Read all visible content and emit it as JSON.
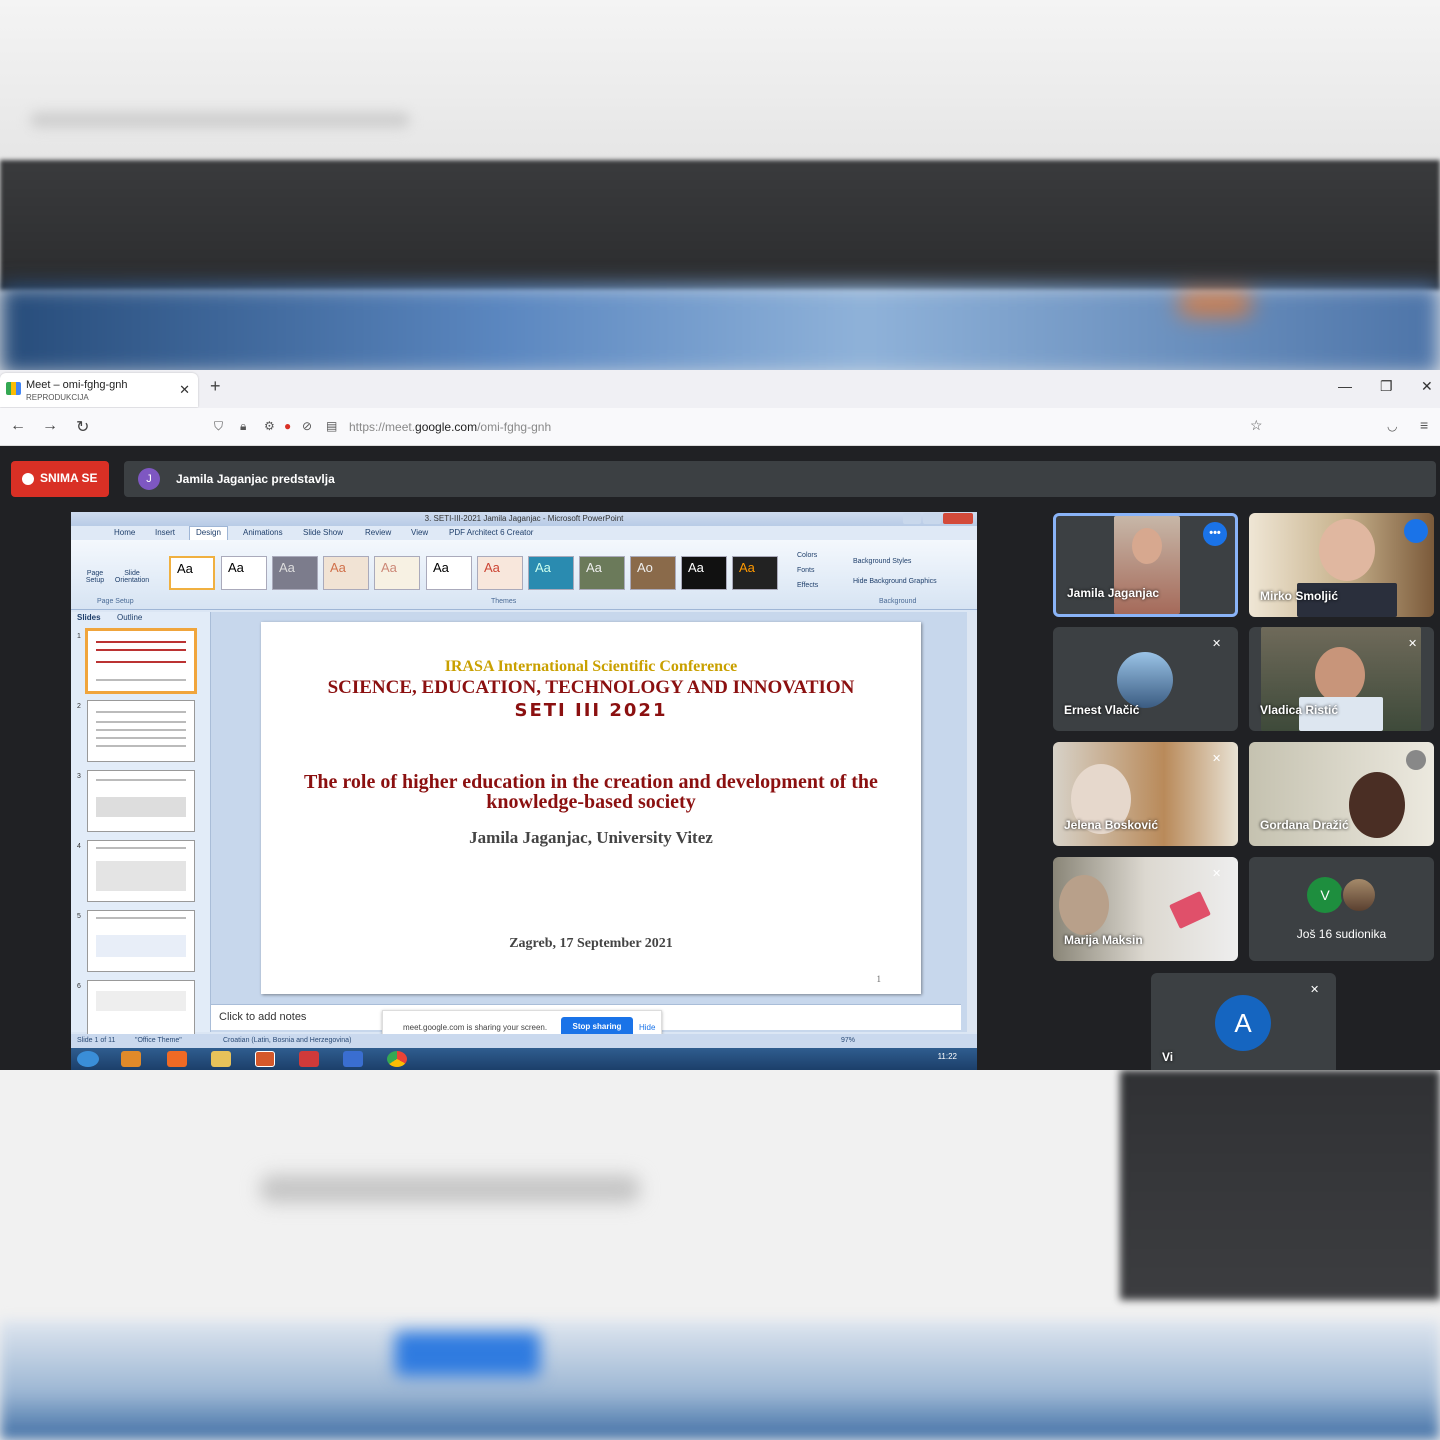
{
  "browser": {
    "tab_title": "Meet – omi-fghg-gnh",
    "tab_subtitle": "REPRODUKCIJA",
    "url_prefix": "https://meet.",
    "url_domain": "google.com",
    "url_path": "/omi-fghg-gnh"
  },
  "meet": {
    "recording_label": "SNIMA SE",
    "presenter_initial": "J",
    "presenter_text": "Jamila Jaganjac predstavlja"
  },
  "powerpoint": {
    "window_title": "3. SETI-III-2021 Jamila Jaganjac - Microsoft PowerPoint",
    "tabs": [
      "Home",
      "Insert",
      "Design",
      "Animations",
      "Slide Show",
      "Review",
      "View",
      "PDF Architect 6 Creator"
    ],
    "active_tab": "Design",
    "page_setup": "Page Setup",
    "slide_orientation": "Slide Orientation",
    "page_setup_group": "Page Setup",
    "themes_group": "Themes",
    "colors": "Colors",
    "fonts": "Fonts",
    "effects": "Effects",
    "bg_styles": "Background Styles",
    "hide_bg": "Hide Background Graphics",
    "background_group": "Background",
    "pane_tab_slides": "Slides",
    "pane_tab_outline": "Outline",
    "slide": {
      "conference": "IRASA International Scientific Conference",
      "science": "SCIENCE, EDUCATION, TECHNOLOGY AND INNOVATION",
      "seti": "SETI III 2021",
      "role": "The role of higher education in the creation and development of the knowledge-based society",
      "author": "Jamila Jaganjac, University Vitez",
      "date": "Zagreb, 17 September 2021",
      "number": "1"
    },
    "notes_placeholder": "Click to add notes",
    "share_message": "meet.google.com is sharing your screen.",
    "stop_sharing": "Stop sharing",
    "hide": "Hide",
    "status_slide": "Slide 1 of 11",
    "status_theme": "\"Office Theme\"",
    "status_lang": "Croatian (Latin, Bosnia and Herzegovina)",
    "zoom": "97%",
    "clock_time": "11:22"
  },
  "participants": [
    {
      "name": "Jamila Jaganjac"
    },
    {
      "name": "Mirko Smoljić"
    },
    {
      "name": "Ernest Vlačić"
    },
    {
      "name": "Vladica Ristić"
    },
    {
      "name": "Jelena Bosković"
    },
    {
      "name": "Gordana Dražić"
    },
    {
      "name": "Marija Maksin"
    },
    {
      "name": "Još 16 sudionika",
      "initial": "V"
    },
    {
      "name": "Vi",
      "initial": "A"
    }
  ],
  "colors": {
    "record_red": "#d93025",
    "meet_blue": "#1a73e8",
    "slide_title_red": "#8b1010",
    "slide_gold": "#c9a000"
  }
}
